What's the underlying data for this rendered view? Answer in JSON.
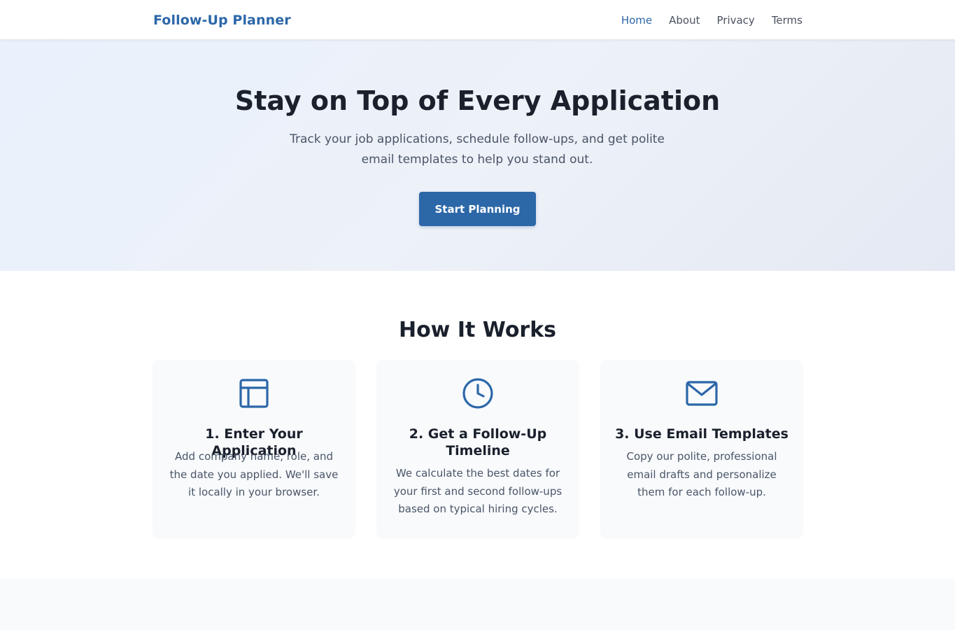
{
  "header": {
    "brand": "Follow-Up Planner",
    "nav": [
      {
        "label": "Home",
        "active": true
      },
      {
        "label": "About",
        "active": false
      },
      {
        "label": "Privacy",
        "active": false
      },
      {
        "label": "Terms",
        "active": false
      }
    ]
  },
  "hero": {
    "title": "Stay on Top of Every Application",
    "subtitle": "Track your job applications, schedule follow-ups, and get polite email templates to help you stand out.",
    "button_label": "Start Planning"
  },
  "how_it_works": {
    "title": "How It Works",
    "cards": [
      {
        "icon": "layout-icon",
        "title": "1. Enter Your Application",
        "text": "Add company name, role, and the date you applied. We'll save it locally in your browser."
      },
      {
        "icon": "clock-icon",
        "title": "2. Get a Follow-Up Timeline",
        "text": "We calculate the best dates for your first and second follow-ups based on typical hiring cycles."
      },
      {
        "icon": "mail-icon",
        "title": "3. Use Email Templates",
        "text": "Copy our polite, professional email drafts and personalize them for each follow-up."
      }
    ]
  },
  "colors": {
    "brand": "#2c67a8",
    "text_dark": "#1a202c",
    "text_muted": "#4a5568",
    "card_bg": "#f8fafc"
  }
}
